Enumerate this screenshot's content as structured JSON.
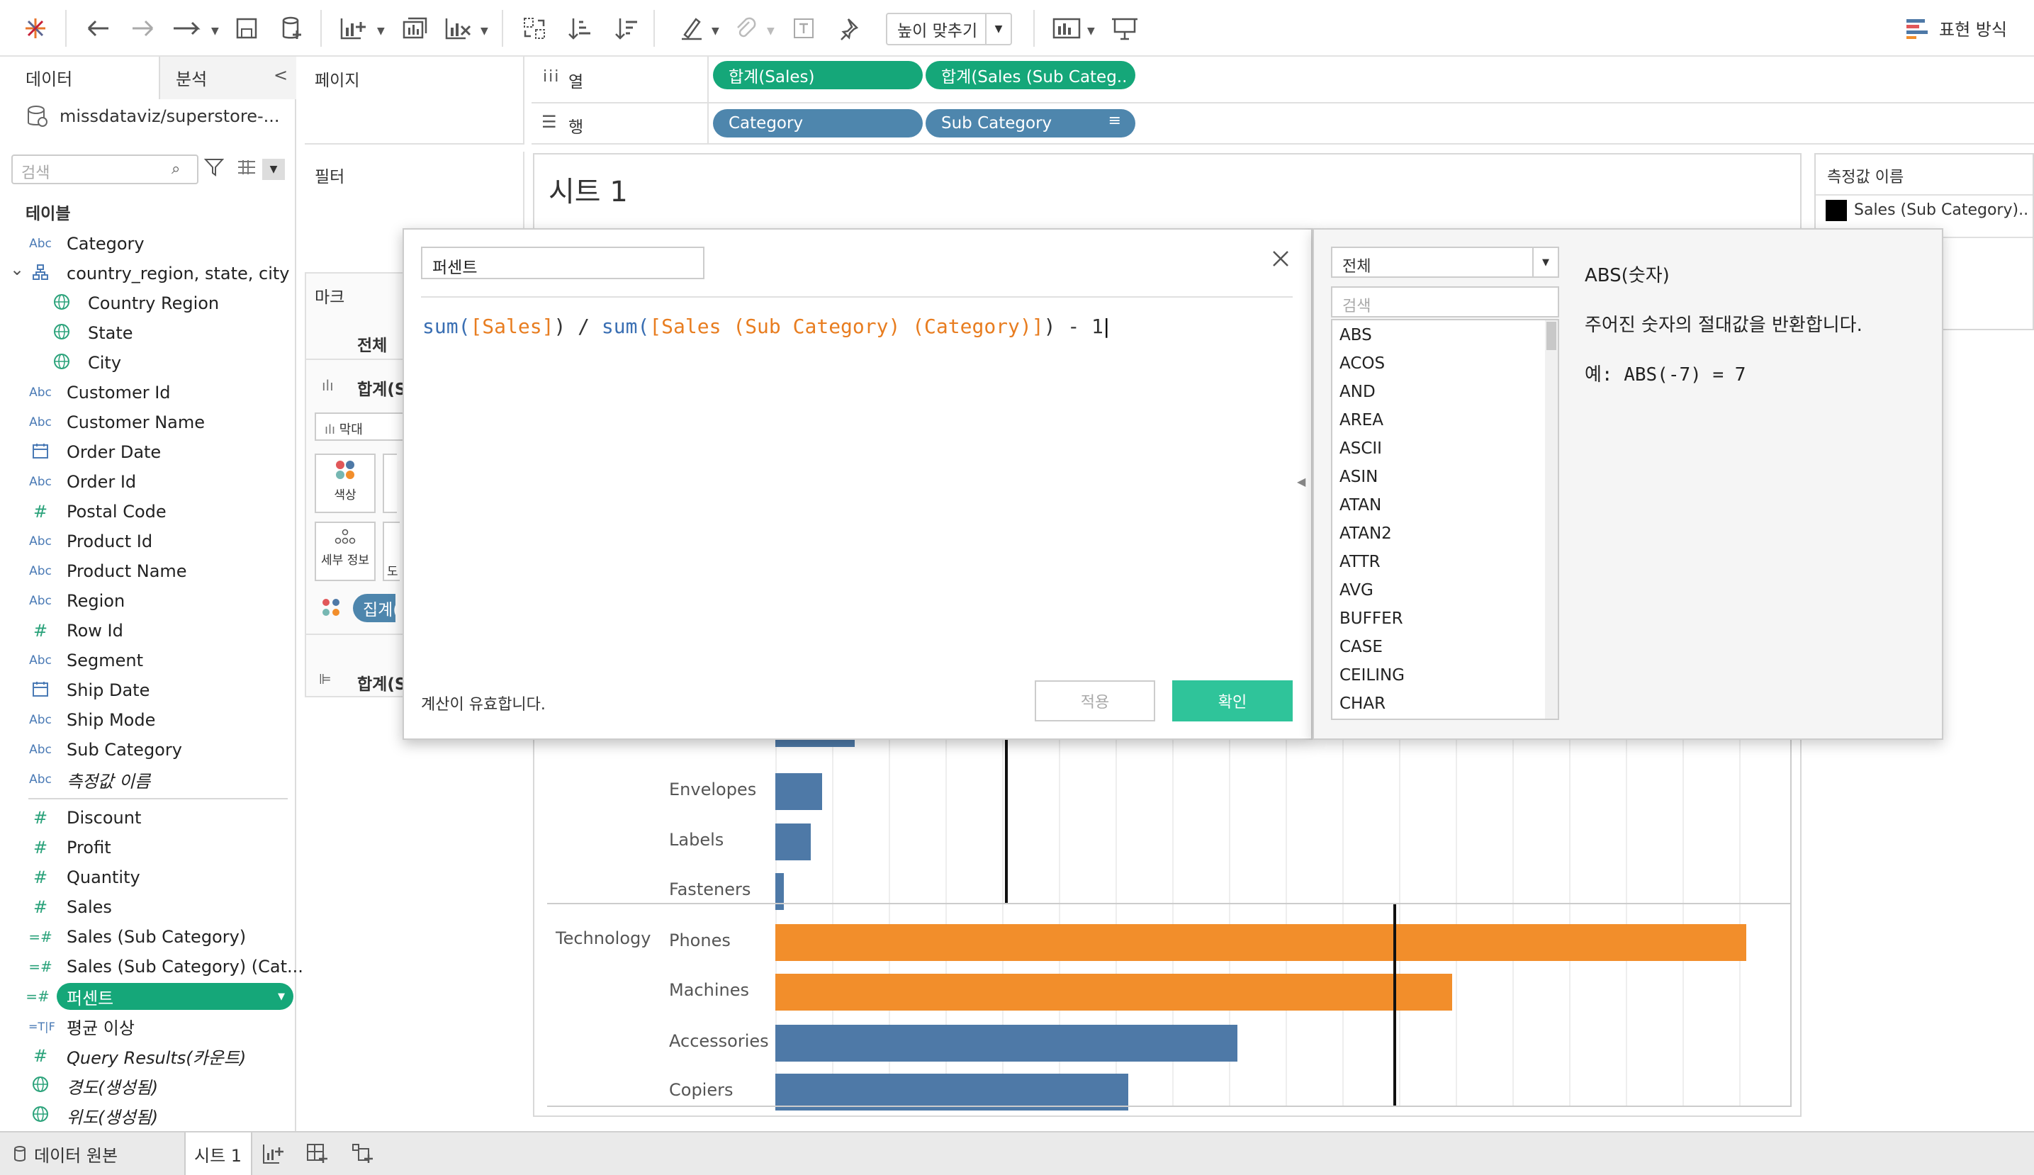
{
  "toolbar": {
    "fit_label": "높이 맞추기",
    "show_me_label": "표현 방식"
  },
  "data_pane": {
    "tab_data": "데이터",
    "tab_analysis": "분석",
    "datasource": "missdataviz/superstore-...",
    "search_placeholder": "검색",
    "tables_header": "테이블",
    "fields": [
      {
        "icon": "Abc",
        "label": "Category"
      },
      {
        "icon": "hierarchy",
        "label": "country_region, state, city"
      },
      {
        "icon": "globe",
        "label": "Country Region"
      },
      {
        "icon": "globe",
        "label": "State"
      },
      {
        "icon": "globe",
        "label": "City"
      },
      {
        "icon": "Abc",
        "label": "Customer Id"
      },
      {
        "icon": "Abc",
        "label": "Customer Name"
      },
      {
        "icon": "date",
        "label": "Order Date"
      },
      {
        "icon": "Abc",
        "label": "Order Id"
      },
      {
        "icon": "#",
        "label": "Postal Code"
      },
      {
        "icon": "Abc",
        "label": "Product Id"
      },
      {
        "icon": "Abc",
        "label": "Product Name"
      },
      {
        "icon": "Abc",
        "label": "Region"
      },
      {
        "icon": "#",
        "label": "Row Id"
      },
      {
        "icon": "Abc",
        "label": "Segment"
      },
      {
        "icon": "date",
        "label": "Ship Date"
      },
      {
        "icon": "Abc",
        "label": "Ship Mode"
      },
      {
        "icon": "Abc",
        "label": "Sub Category"
      },
      {
        "icon": "Abc",
        "label": "측정값 이름"
      },
      {
        "icon": "#",
        "label": "Discount"
      },
      {
        "icon": "#",
        "label": "Profit"
      },
      {
        "icon": "#",
        "label": "Quantity"
      },
      {
        "icon": "#",
        "label": "Sales"
      },
      {
        "icon": "=#",
        "label": "Sales (Sub Category)"
      },
      {
        "icon": "=#",
        "label": "Sales (Sub Category) (Cat..."
      },
      {
        "icon": "=#",
        "label": "퍼센트"
      },
      {
        "icon": "=T|F",
        "label": "평균 이상"
      },
      {
        "icon": "#",
        "label": "Query Results(카운트)"
      },
      {
        "icon": "globe",
        "label": "경도(생성됨)"
      },
      {
        "icon": "globe",
        "label": "위도(생성됨)"
      }
    ]
  },
  "shelves": {
    "pages": "페이지",
    "filters": "필터",
    "marks": "마크",
    "marks_all": "전체",
    "marks_sum": "합계(S",
    "marks_type": "막대",
    "color": "색상",
    "detail": "세부 정보",
    "detail2": "도",
    "agg_pill": "집계(",
    "marks_sum2": "합계(S",
    "columns_label": "열",
    "rows_label": "행",
    "col_pill1": "합계(Sales)",
    "col_pill2": "합계(Sales (Sub Categ..",
    "row_pill1": "Category",
    "row_pill2": "Sub Category"
  },
  "view": {
    "title": "시트 1",
    "legend_title": "측정값 이름",
    "legend_item": "Sales (Sub Category).."
  },
  "chart_data": {
    "type": "bar",
    "groups": [
      {
        "category": "",
        "items": [
          {
            "name": "Envelopes",
            "value": 16,
            "highlight": false
          },
          {
            "name": "Labels",
            "value": 12,
            "highlight": false
          },
          {
            "name": "Fasteners",
            "value": 3,
            "highlight": false
          }
        ]
      },
      {
        "category": "Technology",
        "items": [
          {
            "name": "Phones",
            "value": 330,
            "highlight": true
          },
          {
            "name": "Machines",
            "value": 230,
            "highlight": true
          },
          {
            "name": "Accessories",
            "value": 157,
            "highlight": false
          },
          {
            "name": "Copiers",
            "value": 120,
            "highlight": false
          }
        ]
      }
    ],
    "reference_lines": [
      {
        "group": 0,
        "value": 78
      },
      {
        "group": 1,
        "value": 210
      }
    ],
    "colors": {
      "normal": "#4e79a7",
      "highlight": "#f28e2b"
    }
  },
  "dialog": {
    "name": "퍼센트",
    "formula_parts": [
      {
        "t": "sum(",
        "k": "fk"
      },
      {
        "t": "[Sales]",
        "k": "ff"
      },
      {
        "t": ") / ",
        "k": "fo"
      },
      {
        "t": "sum(",
        "k": "fk"
      },
      {
        "t": "[Sales (Sub Category) (Category)]",
        "k": "ff"
      },
      {
        "t": ") - 1",
        "k": "fo"
      }
    ],
    "status": "계산이 유효합니다.",
    "apply": "적용",
    "ok": "확인"
  },
  "functions": {
    "category": "전체",
    "search_placeholder": "검색",
    "list": [
      "ABS",
      "ACOS",
      "AND",
      "AREA",
      "ASCII",
      "ASIN",
      "ATAN",
      "ATAN2",
      "ATTR",
      "AVG",
      "BUFFER",
      "CASE",
      "CEILING",
      "CHAR"
    ],
    "detail_title": "ABS(숫자)",
    "detail_desc": "주어진 숫자의 절대값을 반환합니다.",
    "detail_example": "예: ABS(-7) = 7"
  },
  "bottom": {
    "datasource_tab": "데이터 원본",
    "sheet_tab": "시트 1"
  }
}
